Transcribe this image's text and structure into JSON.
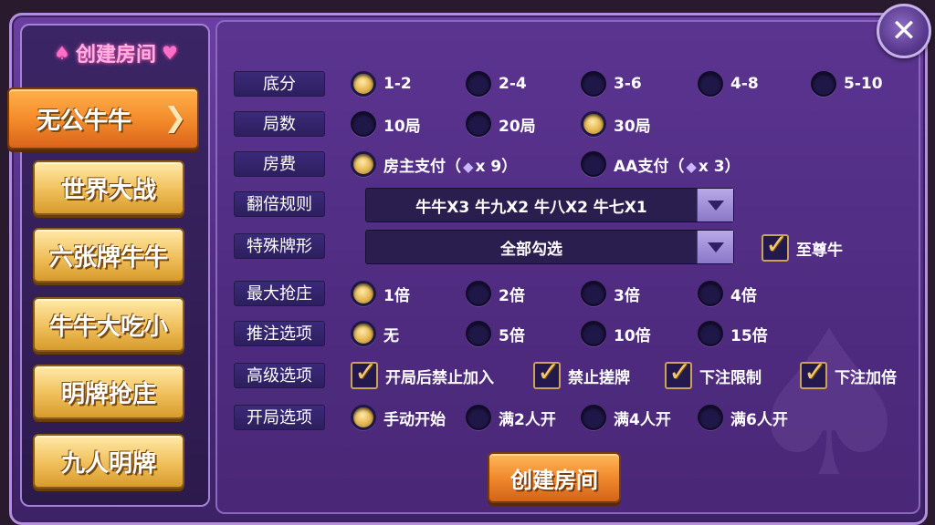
{
  "left_panel": {
    "title": "创建房间",
    "suit_left": "♠",
    "suit_right": "♥",
    "tabs": [
      {
        "label": "无公牛牛",
        "active": true
      },
      {
        "label": "世界大战",
        "active": false
      },
      {
        "label": "六张牌牛牛",
        "active": false
      },
      {
        "label": "牛牛大吃小",
        "active": false
      },
      {
        "label": "明牌抢庄",
        "active": false
      },
      {
        "label": "九人明牌",
        "active": false
      }
    ],
    "active_arrow": "❯"
  },
  "close_icon": "✕",
  "form": {
    "base_score": {
      "label": "底分",
      "options": [
        "1-2",
        "2-4",
        "3-6",
        "4-8",
        "5-10"
      ],
      "selected": "1-2"
    },
    "rounds": {
      "label": "局数",
      "options": [
        "10局",
        "20局",
        "30局"
      ],
      "selected": "30局"
    },
    "room_fee": {
      "label": "房费",
      "options": [
        {
          "text": "房主支付（",
          "diamond": "💎",
          "suffix": "x 9）"
        },
        {
          "text": "AA支付（",
          "diamond": "💎",
          "suffix": "x 3）"
        }
      ],
      "selected": "房主支付"
    },
    "multiplier_rule": {
      "label": "翻倍规则",
      "value": "牛牛X3 牛九X2 牛八X2 牛七X1"
    },
    "special_hands": {
      "label": "特殊牌形",
      "value": "全部勾选",
      "checkbox_label": "至尊牛",
      "checked": true
    },
    "max_banker_bid": {
      "label": "最大抢庄",
      "options": [
        "1倍",
        "2倍",
        "3倍",
        "4倍"
      ],
      "selected": "1倍"
    },
    "push_bet": {
      "label": "推注选项",
      "options": [
        "无",
        "5倍",
        "10倍",
        "15倍"
      ],
      "selected": "无"
    },
    "advanced": {
      "label": "高级选项",
      "options": [
        {
          "text": "开局后禁止加入",
          "checked": true
        },
        {
          "text": "禁止搓牌",
          "checked": true
        },
        {
          "text": "下注限制",
          "checked": true
        },
        {
          "text": "下注加倍",
          "checked": true
        }
      ]
    },
    "start_option": {
      "label": "开局选项",
      "options": [
        "手动开始",
        "满2人开",
        "满4人开",
        "满6人开"
      ],
      "selected": "手动开始"
    }
  },
  "create_button": "创建房间",
  "colors": {
    "gold": "#e9be5c",
    "orange": "#f18a2e",
    "purple_bg": "#4d2a7d",
    "label_bg": "#2c1f5e"
  }
}
